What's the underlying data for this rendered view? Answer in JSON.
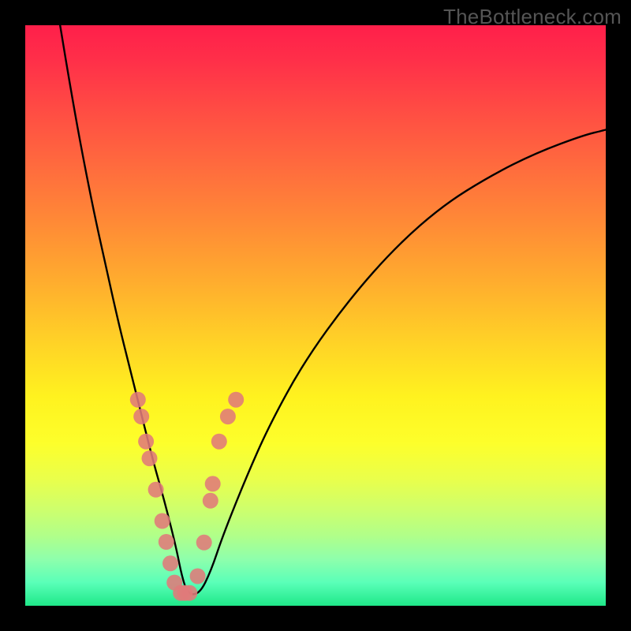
{
  "watermark": "TheBottleneck.com",
  "colors": {
    "frame": "#000000",
    "curve": "#000000",
    "marker_fill": "#e07a7a",
    "marker_stroke": "#c96666"
  },
  "chart_data": {
    "type": "line",
    "title": "",
    "xlabel": "",
    "ylabel": "",
    "xlim": [
      0,
      100
    ],
    "ylim": [
      0,
      100
    ],
    "grid": false,
    "legend": false,
    "annotations": [
      "TheBottleneck.com"
    ],
    "note": "No axis ticks or data labels are visible; x and y values below are estimated in percent of plot width/height from the rendered curve. y increases upward.",
    "series": [
      {
        "name": "bottleneck-curve",
        "x": [
          6,
          8,
          10,
          12,
          14,
          16,
          18,
          20,
          22,
          24,
          26,
          27,
          28,
          30,
          32,
          34,
          38,
          42,
          48,
          56,
          64,
          72,
          80,
          88,
          96,
          100
        ],
        "y": [
          100,
          88,
          77,
          67,
          58,
          49,
          41,
          33,
          25,
          18,
          10,
          5,
          2,
          2,
          6,
          12,
          22,
          31,
          42,
          53,
          62,
          69,
          74,
          78,
          81,
          82
        ]
      }
    ],
    "markers": {
      "name": "highlighted-points",
      "x_percent": [
        19.4,
        20.0,
        20.8,
        21.4,
        22.5,
        23.6,
        24.3,
        25.0,
        25.7,
        26.8,
        27.5,
        28.3,
        29.7,
        30.8,
        31.9,
        32.3,
        33.4,
        34.9,
        36.3
      ],
      "y_percent": [
        35.5,
        32.6,
        28.3,
        25.4,
        20.0,
        14.6,
        11.0,
        7.3,
        4.0,
        2.2,
        2.2,
        2.2,
        5.1,
        10.9,
        18.1,
        21.0,
        28.3,
        32.6,
        35.5
      ]
    }
  }
}
